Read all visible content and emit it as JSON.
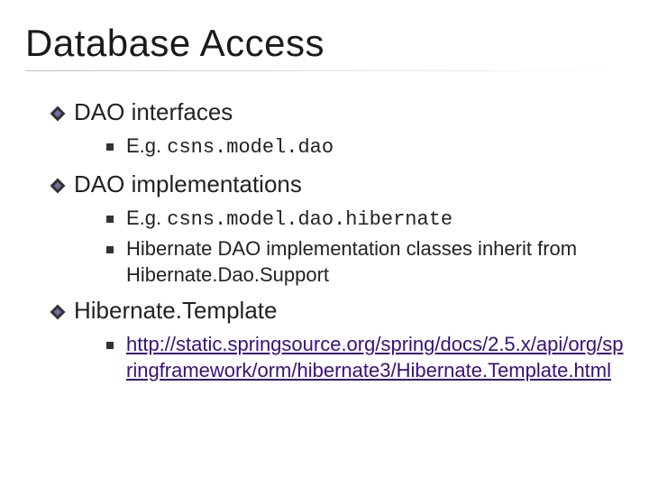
{
  "title": "Database Access",
  "items": [
    {
      "label": "DAO interfaces",
      "sub": [
        {
          "prefix": "E.g. ",
          "code": "csns.model.dao"
        }
      ]
    },
    {
      "label": "DAO implementations",
      "sub": [
        {
          "prefix": "E.g. ",
          "code": "csns.model.dao.hibernate"
        },
        {
          "text": "Hibernate DAO implementation classes inherit from Hibernate.Dao.Support"
        }
      ]
    },
    {
      "label": "Hibernate.Template",
      "sub": [
        {
          "link": "http://static.springsource.org/spring/docs/2.5.x/api/org/springframework/orm/hibernate3/Hibernate.Template.html"
        }
      ]
    }
  ]
}
